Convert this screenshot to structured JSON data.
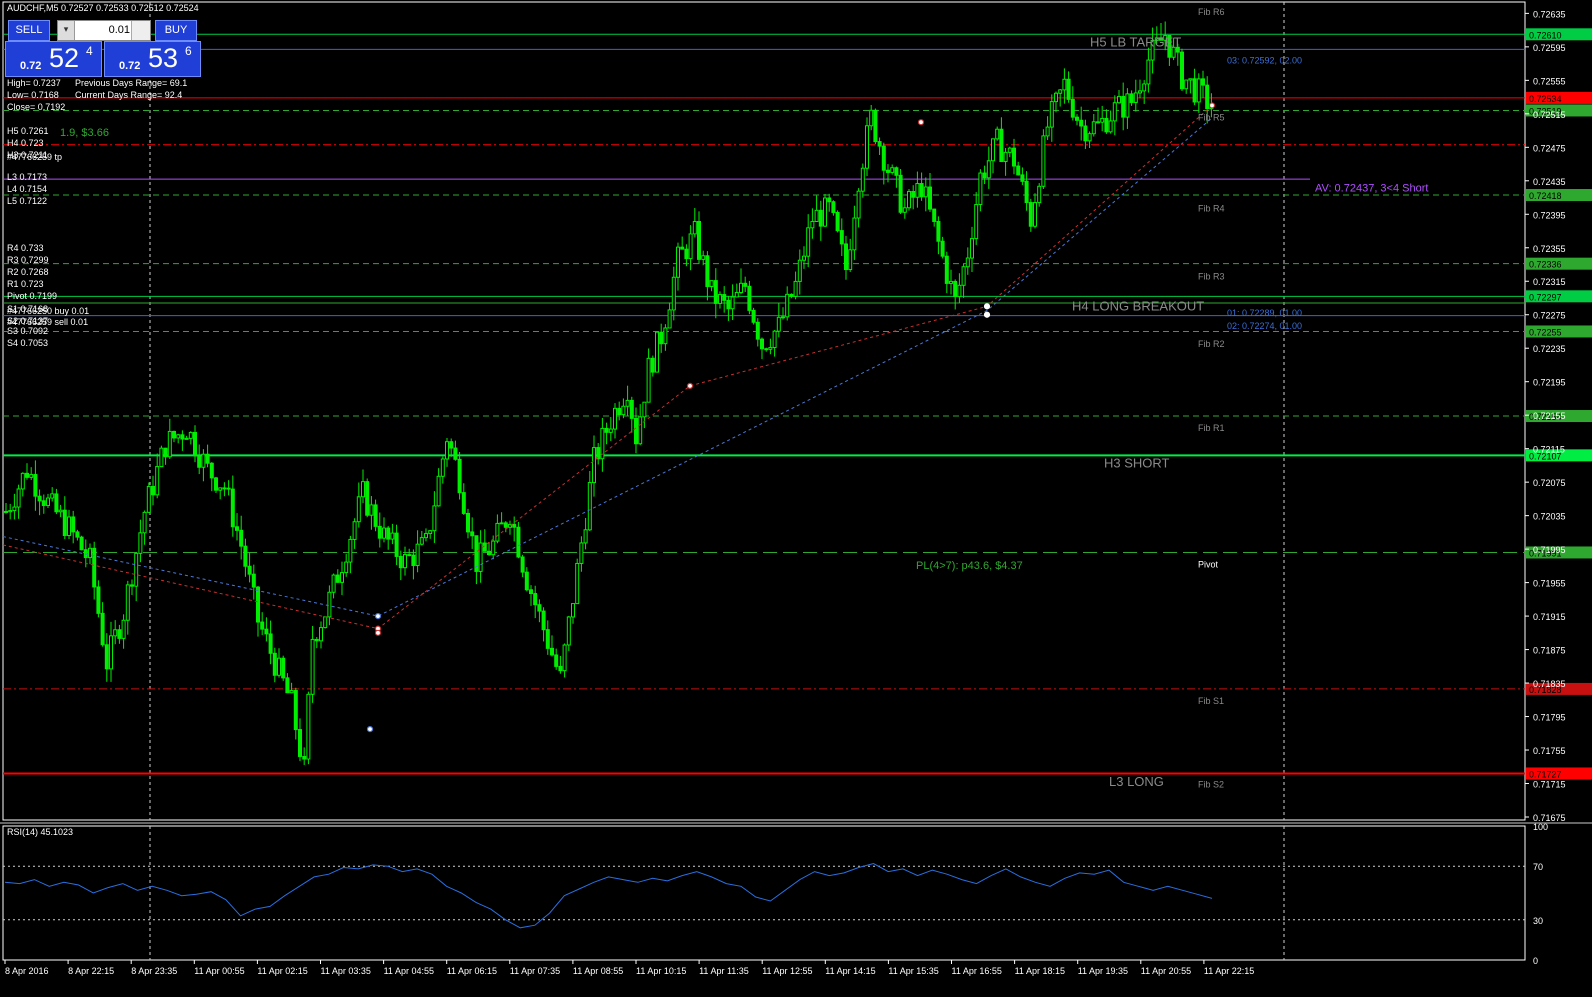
{
  "window": {
    "symbol_header": "AUDCHF,M5  0.72527 0.72533 0.72512 0.72524",
    "rsi_label": "RSI(14) 45.1023"
  },
  "trade_panel": {
    "sell_label": "SELL",
    "buy_label": "BUY",
    "lot_value": "0.01",
    "sell_price": {
      "prefix": "0.72",
      "big": "52",
      "sup": "4"
    },
    "buy_price": {
      "prefix": "0.72",
      "big": "53",
      "sup": "6"
    }
  },
  "info_lines": {
    "high": "High= 0.7237",
    "low": "Low= 0.7168",
    "close": "Close= 0.7192",
    "prev_range": "Previous Days Range= 69.1",
    "curr_range": "Current Days Range= 92.4",
    "profit_overlay": "1.9, $3.66"
  },
  "pivot_levels": [
    "H5 0.7261",
    "H4 0.723",
    "H3 0.7211",
    "#47766259 tp",
    "",
    "L3 0.7173",
    "L4 0.7154",
    "L5 0.7122",
    "",
    "",
    "",
    "R4 0.733",
    "R3 0.7299",
    "R2 0.7268",
    "R1 0.723",
    "Pivot 0.7199",
    "S1 0.7168",
    "#47766250 buy 0.01",
    "S2 0.7137",
    "#47766259 sell 0.01",
    "S3 0.7092",
    "S4 0.7053"
  ],
  "chart_data": {
    "type": "candlestick",
    "symbol": "AUDCHF",
    "timeframe": "M5",
    "ylim": [
      0.71675,
      0.72645
    ],
    "y_ticks": [
      "0.72635",
      "0.72595",
      "0.72555",
      "0.72515",
      "0.72475",
      "0.72435",
      "0.72395",
      "0.72355",
      "0.72315",
      "0.72275",
      "0.72235",
      "0.72195",
      "0.72155",
      "0.72115",
      "0.72075",
      "0.72035",
      "0.71995",
      "0.71955",
      "0.71915",
      "0.71875",
      "0.71835",
      "0.71795",
      "0.71755",
      "0.71715",
      "0.71675"
    ],
    "x_ticks": [
      "8 Apr 2016",
      "8 Apr 22:15",
      "8 Apr 23:35",
      "11 Apr 00:55",
      "11 Apr 02:15",
      "11 Apr 03:35",
      "11 Apr 04:55",
      "11 Apr 06:15",
      "11 Apr 07:35",
      "11 Apr 08:55",
      "11 Apr 10:15",
      "11 Apr 11:35",
      "11 Apr 12:55",
      "11 Apr 14:15",
      "11 Apr 15:35",
      "11 Apr 16:55",
      "11 Apr 18:15",
      "11 Apr 19:35",
      "11 Apr 20:55",
      "11 Apr 22:15"
    ],
    "price_path": [
      [
        0,
        0.7204
      ],
      [
        5,
        0.7209
      ],
      [
        10,
        0.7205
      ],
      [
        15,
        0.7202
      ],
      [
        20,
        0.7198
      ],
      [
        24,
        0.7186
      ],
      [
        28,
        0.7192
      ],
      [
        33,
        0.7204
      ],
      [
        38,
        0.7212
      ],
      [
        43,
        0.7214
      ],
      [
        48,
        0.7209
      ],
      [
        52,
        0.7207
      ],
      [
        56,
        0.72
      ],
      [
        60,
        0.7191
      ],
      [
        64,
        0.7186
      ],
      [
        68,
        0.7181
      ],
      [
        71,
        0.7173
      ],
      [
        73,
        0.7189
      ],
      [
        76,
        0.7192
      ],
      [
        80,
        0.7198
      ],
      [
        85,
        0.7206
      ],
      [
        90,
        0.7201
      ],
      [
        95,
        0.7198
      ],
      [
        100,
        0.72
      ],
      [
        105,
        0.7213
      ],
      [
        108,
        0.7208
      ],
      [
        112,
        0.7198
      ],
      [
        116,
        0.72
      ],
      [
        120,
        0.7204
      ],
      [
        124,
        0.7196
      ],
      [
        128,
        0.719
      ],
      [
        132,
        0.7184
      ],
      [
        136,
        0.7197
      ],
      [
        140,
        0.721
      ],
      [
        144,
        0.7215
      ],
      [
        148,
        0.7219
      ],
      [
        150,
        0.7213
      ],
      [
        153,
        0.7221
      ],
      [
        156,
        0.7225
      ],
      [
        160,
        0.7234
      ],
      [
        164,
        0.7237
      ],
      [
        168,
        0.723
      ],
      [
        172,
        0.7228
      ],
      [
        176,
        0.7231
      ],
      [
        180,
        0.7224
      ],
      [
        184,
        0.7226
      ],
      [
        188,
        0.7231
      ],
      [
        192,
        0.7239
      ],
      [
        196,
        0.724
      ],
      [
        200,
        0.7233
      ],
      [
        203,
        0.7244
      ],
      [
        206,
        0.7251
      ],
      [
        210,
        0.7245
      ],
      [
        214,
        0.724
      ],
      [
        218,
        0.7243
      ],
      [
        222,
        0.7236
      ],
      [
        226,
        0.7229
      ],
      [
        229,
        0.7235
      ],
      [
        232,
        0.7244
      ],
      [
        236,
        0.7248
      ],
      [
        240,
        0.7246
      ],
      [
        244,
        0.7239
      ],
      [
        248,
        0.725
      ],
      [
        252,
        0.7255
      ],
      [
        256,
        0.725
      ],
      [
        260,
        0.725
      ],
      [
        264,
        0.7252
      ],
      [
        268,
        0.7253
      ],
      [
        272,
        0.7258
      ],
      [
        276,
        0.7261
      ],
      [
        280,
        0.7256
      ],
      [
        284,
        0.7254
      ],
      [
        288,
        0.7252
      ]
    ],
    "horizontal_levels": [
      {
        "value": 0.7261,
        "color": "#00cc44",
        "style": "solid",
        "label": "0.72610"
      },
      {
        "value": 0.72592,
        "color": "#4a5bd6",
        "style": "solid",
        "label": ""
      },
      {
        "value": 0.72534,
        "color": "#ff0000",
        "style": "solid",
        "label": "0.72534"
      },
      {
        "value": 0.72519,
        "color": "#2fa82f",
        "style": "dash",
        "label": "0.72519"
      },
      {
        "value": 0.72478,
        "color": "#ff0000",
        "style": "dashdot",
        "label": ""
      },
      {
        "value": 0.72437,
        "color": "#b050ff",
        "style": "solid",
        "label": ""
      },
      {
        "value": 0.72418,
        "color": "#2fa82f",
        "style": "dash",
        "label": "0.72418"
      },
      {
        "value": 0.72336,
        "color": "#2fa82f",
        "style": "dash",
        "label": "0.72336"
      },
      {
        "value": 0.72297,
        "color": "#00cc44",
        "style": "solid",
        "label": "0.72297"
      },
      {
        "value": 0.72289,
        "color": "#2fa82f",
        "style": "solid",
        "label": ""
      },
      {
        "value": 0.72274,
        "color": "#4a5bd6",
        "style": "solid",
        "label": ""
      },
      {
        "value": 0.72255,
        "color": "#2fa82f",
        "style": "dash",
        "label": "0.72255"
      },
      {
        "value": 0.72154,
        "color": "#2fa82f",
        "style": "dash",
        "label": "0.72154"
      },
      {
        "value": 0.72107,
        "color": "#00ee44",
        "style": "thick",
        "label": "0.72107"
      },
      {
        "value": 0.71991,
        "color": "#2fa82f",
        "style": "longdash",
        "label": "0.71991"
      },
      {
        "value": 0.71828,
        "color": "#c81010",
        "style": "dashdot",
        "label": "0.71828"
      },
      {
        "value": 0.71727,
        "color": "#ff0000",
        "style": "thick",
        "label": "0.71727"
      }
    ],
    "annotations": [
      {
        "text": "H5 LB TARGET",
        "price": 0.726,
        "color": "#8a8a8a"
      },
      {
        "text": "H4 LONG BREAKOUT",
        "price": 0.72285,
        "color": "#8a8a8a"
      },
      {
        "text": "H3 SHORT",
        "price": 0.72097,
        "color": "#8a8a8a"
      },
      {
        "text": "L3 LONG",
        "price": 0.71717,
        "color": "#8a8a8a"
      },
      {
        "text": "AV: 0.72437, 3<4 Short",
        "price": 0.72427,
        "color": "#b050ff"
      },
      {
        "text": "PL(4>7): p43.6, $4.37",
        "price": 0.71976,
        "color": "#2fa82f"
      },
      {
        "text": "03: 0.72592, 02.00",
        "price": 0.7258,
        "color": "#3a6ed6"
      },
      {
        "text": "01: 0.72289, 01.00",
        "price": 0.72278,
        "color": "#3a6ed6"
      },
      {
        "text": "02: 0.72274, 01.00",
        "price": 0.72263,
        "color": "#3a6ed6"
      }
    ],
    "fib_labels": [
      {
        "text": "Fib R6",
        "price": 0.72638
      },
      {
        "text": "Fib R5",
        "price": 0.72512
      },
      {
        "text": "Fib R4",
        "price": 0.72403
      },
      {
        "text": "Fib R3",
        "price": 0.72322
      },
      {
        "text": "Fib R2",
        "price": 0.72241
      },
      {
        "text": "Fib R1",
        "price": 0.72141
      },
      {
        "text": "Pivot",
        "price": 0.71978
      },
      {
        "text": "Fib S1",
        "price": 0.71815
      },
      {
        "text": "Fib S2",
        "price": 0.71715
      }
    ],
    "rsi": {
      "period": 14,
      "last": 45.1023,
      "ylim": [
        0,
        100
      ],
      "y_ticks": [
        "100",
        "70",
        "30",
        "0"
      ],
      "levels": [
        70,
        30
      ],
      "values": [
        58,
        57,
        60,
        55,
        58,
        56,
        50,
        54,
        57,
        52,
        55,
        52,
        48,
        49,
        51,
        45,
        33,
        38,
        40,
        48,
        55,
        62,
        64,
        69,
        68,
        71,
        70,
        66,
        68,
        64,
        55,
        50,
        43,
        38,
        30,
        24,
        26,
        35,
        48,
        53,
        58,
        62,
        60,
        58,
        61,
        59,
        63,
        66,
        62,
        57,
        55,
        47,
        44,
        52,
        60,
        66,
        63,
        65,
        69,
        72,
        66,
        68,
        63,
        67,
        64,
        60,
        57,
        63,
        68,
        62,
        58,
        55,
        61,
        65,
        64,
        67,
        58,
        55,
        52,
        55,
        52,
        49,
        46
      ]
    }
  }
}
